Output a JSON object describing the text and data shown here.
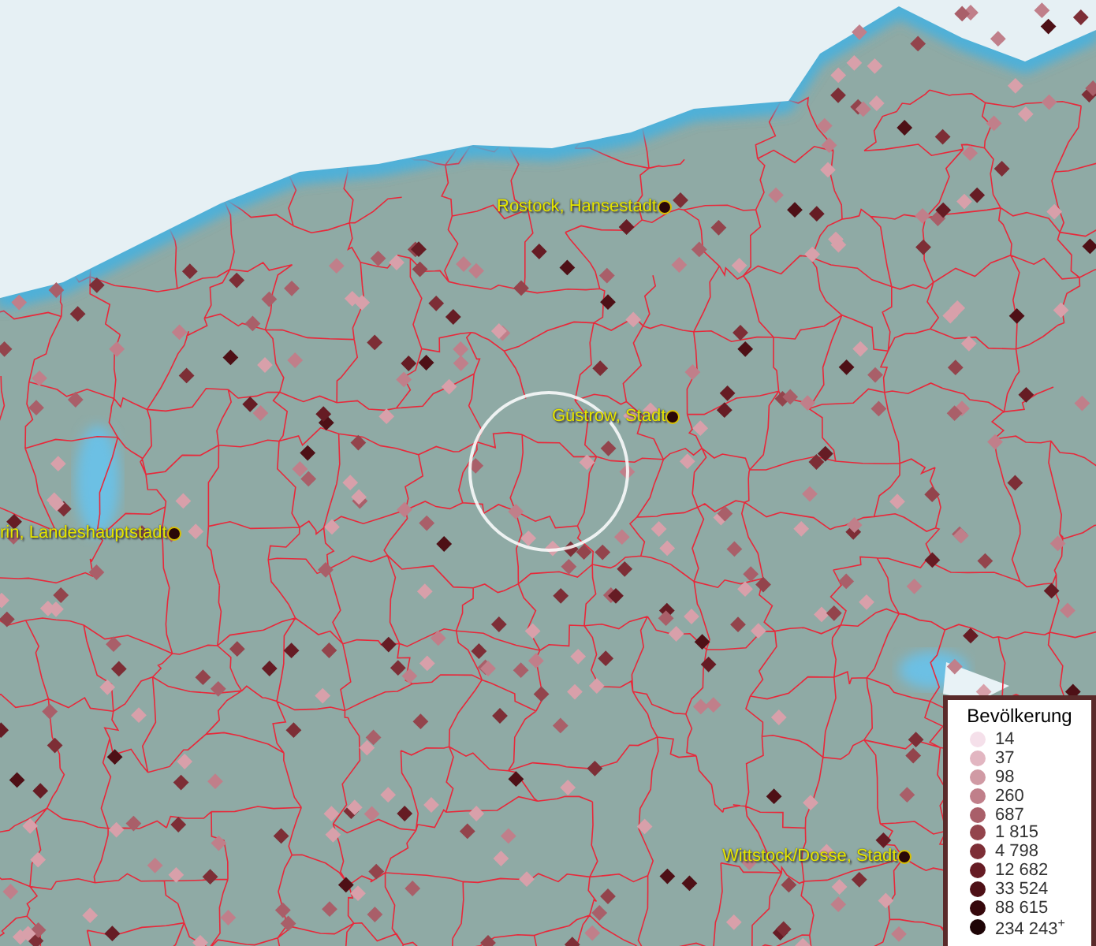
{
  "map": {
    "cities": [
      {
        "label": "Rostock, Hansestadt"
      },
      {
        "label": "Güstrow, Stadt"
      },
      {
        "label": "rin, Landeshauptstadt"
      },
      {
        "label": "Wittstock/Dosse, Stadt"
      }
    ]
  },
  "legend": {
    "title": "Bevölkerung",
    "items": [
      {
        "label": "14",
        "color": "#f5e0ea"
      },
      {
        "label": "37",
        "color": "#e2b6c1"
      },
      {
        "label": "98",
        "color": "#d09aa4"
      },
      {
        "label": "260",
        "color": "#c07f8a"
      },
      {
        "label": "687",
        "color": "#a95f69"
      },
      {
        "label": "1 815",
        "color": "#93444c"
      },
      {
        "label": "4 798",
        "color": "#7d2e36"
      },
      {
        "label": "12 682",
        "color": "#661c24"
      },
      {
        "label": "33 524",
        "color": "#4e1016"
      },
      {
        "label": "88 615",
        "color": "#36080c"
      },
      {
        "label": "234 243$^{+}$",
        "color": "#1e0406"
      }
    ]
  }
}
